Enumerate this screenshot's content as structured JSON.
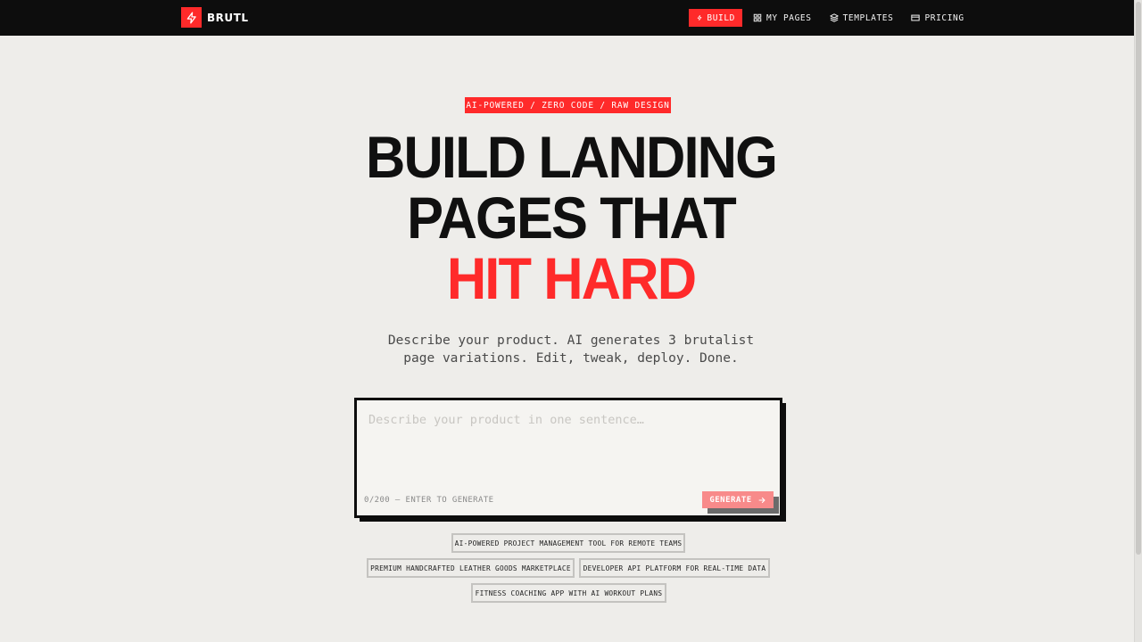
{
  "nav": {
    "brand": "BRUTL",
    "links": [
      {
        "label": "BUILD",
        "icon": "bolt-icon"
      },
      {
        "label": "MY PAGES",
        "icon": "grid-icon"
      },
      {
        "label": "TEMPLATES",
        "icon": "layers-icon"
      },
      {
        "label": "PRICING",
        "icon": "card-icon"
      }
    ]
  },
  "hero": {
    "badge": "AI-POWERED / ZERO CODE / RAW DESIGN",
    "headline_line1": "BUILD LANDING",
    "headline_line2": "PAGES THAT",
    "headline_accent": "HIT HARD",
    "subtitle_line1": "Describe your product. AI generates 3 brutalist",
    "subtitle_line2": "page variations. Edit, tweak, deploy. Done."
  },
  "input": {
    "value": "",
    "placeholder": "Describe your product in one sentence…",
    "counter": "0/200 — ENTER TO GENERATE",
    "generate_label": "GENERATE"
  },
  "suggestions": [
    "AI-POWERED PROJECT MANAGEMENT TOOL FOR REMOTE TEAMS",
    "PREMIUM HANDCRAFTED LEATHER GOODS MARKETPLACE",
    "DEVELOPER API PLATFORM FOR REAL-TIME DATA",
    "FITNESS COACHING APP WITH AI WORKOUT PLANS"
  ],
  "colors": {
    "accent": "#ff2a2a",
    "nav_bg": "#0d0d0d",
    "page_bg": "#eeedea"
  }
}
